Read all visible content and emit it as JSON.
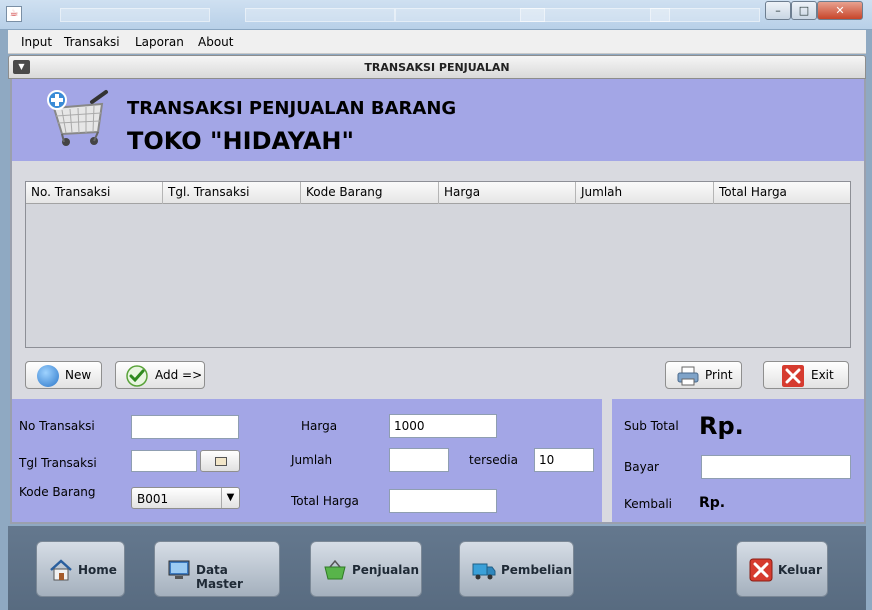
{
  "menubar": {
    "items": [
      "Input",
      "Transaksi",
      "Laporan",
      "About"
    ]
  },
  "frame": {
    "title": "TRANSAKSI PENJUALAN"
  },
  "header": {
    "line1": "TRANSAKSI PENJUALAN BARANG",
    "line2": "TOKO \"HIDAYAH\""
  },
  "table": {
    "columns": [
      "No. Transaksi",
      "Tgl. Transaksi",
      "Kode Barang",
      "Harga",
      "Jumlah",
      "Total Harga"
    ],
    "rows": []
  },
  "actions": {
    "new_label": "New",
    "add_label": "Add =>",
    "print_label": "Print",
    "exit_label": "Exit"
  },
  "form": {
    "no_transaksi_label": "No Transaksi",
    "no_transaksi_value": "",
    "tgl_transaksi_label": "Tgl Transaksi",
    "tgl_transaksi_value": "",
    "kode_barang_label": "Kode Barang",
    "kode_barang_value": "B001",
    "harga_label": "Harga",
    "harga_value": "1000",
    "jumlah_label": "Jumlah",
    "jumlah_value": "",
    "tersedia_label": "tersedia",
    "tersedia_value": "10",
    "total_harga_label": "Total Harga",
    "total_harga_value": ""
  },
  "summary": {
    "subtotal_label": "Sub Total",
    "subtotal_value": "Rp.",
    "bayar_label": "Bayar",
    "bayar_value": "",
    "kembali_label": "Kembali",
    "kembali_value": "Rp."
  },
  "nav": {
    "home": "Home",
    "data_master": "Data Master",
    "penjualan": "Penjualan",
    "pembelian": "Pembelian",
    "keluar": "Keluar"
  },
  "window": {
    "min": "–",
    "max": "□",
    "close": "✕"
  },
  "colors": {
    "panel": "#a3a6e6",
    "body": "#d9dae0",
    "nav": "#5f7388"
  }
}
